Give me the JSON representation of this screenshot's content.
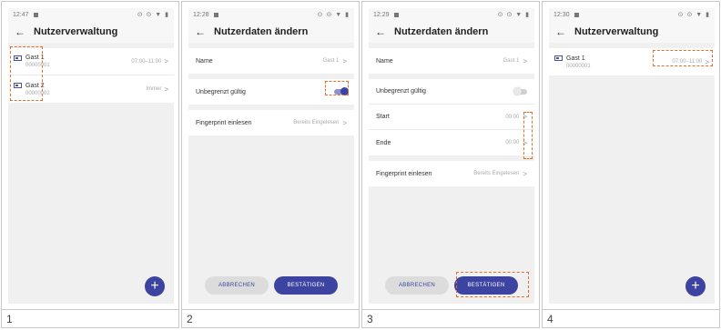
{
  "status": {
    "p1_time": "12:47",
    "p2_time": "12:28",
    "p3_time": "12:29",
    "p4_time": "12:30",
    "icons": "⊙ ⊙ ▼ ▮"
  },
  "titles": {
    "user_management": "Nutzerverwaltung",
    "edit_user": "Nutzerdaten ändern"
  },
  "users": [
    {
      "name": "Gast 1",
      "id": "00000001",
      "time": "07:00–11:00"
    },
    {
      "name": "Gast 2",
      "id": "00000002",
      "time": "Immer"
    }
  ],
  "form": {
    "name_label": "Name",
    "name_value": "Gast 1",
    "unlimited_label": "Unbegrenzt gültig",
    "start_label": "Start",
    "start_value": "00:00",
    "end_label": "Ende",
    "end_value": "00:00",
    "fingerprint_label": "Fingerprint einlesen",
    "fingerprint_value": "Bereits Eingelesen"
  },
  "buttons": {
    "cancel": "ABBRECHEN",
    "confirm": "BESTÄTIGEN"
  },
  "fab": "+",
  "chevron": ">",
  "captions": [
    "1",
    "2",
    "3",
    "4"
  ],
  "toggles": {
    "p2_unlimited": "on",
    "p3_unlimited": "off"
  },
  "colors": {
    "accent": "#3d43a0",
    "highlight": "#e2702b"
  }
}
